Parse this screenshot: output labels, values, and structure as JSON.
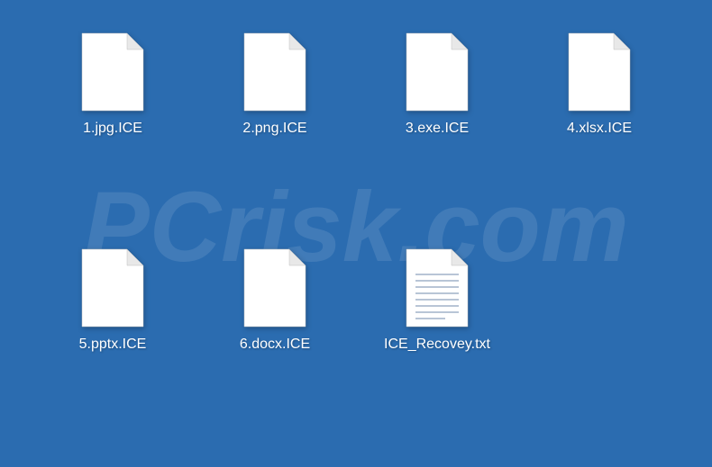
{
  "files": [
    {
      "name": "1.jpg.ICE",
      "type": "blank"
    },
    {
      "name": "2.png.ICE",
      "type": "blank"
    },
    {
      "name": "3.exe.ICE",
      "type": "blank"
    },
    {
      "name": "4.xlsx.ICE",
      "type": "blank"
    },
    {
      "name": "5.pptx.ICE",
      "type": "blank"
    },
    {
      "name": "6.docx.ICE",
      "type": "blank"
    },
    {
      "name": "ICE_Recovey.txt",
      "type": "text"
    }
  ],
  "watermark": "PCrisk.com"
}
